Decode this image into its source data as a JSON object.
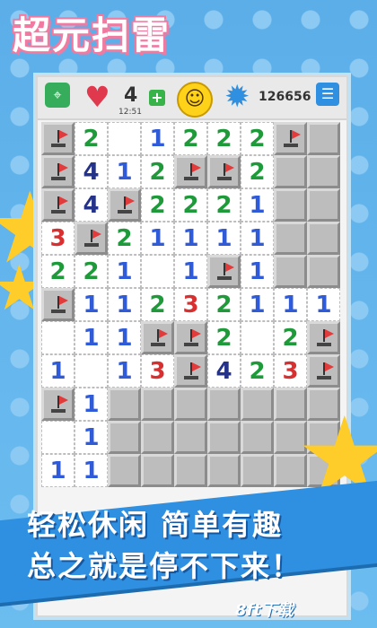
{
  "title": "超元扫雷",
  "topbar": {
    "lives": "4",
    "timer": "12:51",
    "score": "126656",
    "location_icon": "location-pin-icon",
    "heart_icon": "heart-icon",
    "plus_icon": "plus-icon",
    "smile_icon": "smiley-face-icon",
    "gear_icon": "gear-icon",
    "menu_icon": "menu-list-icon"
  },
  "board": {
    "rows": [
      [
        "F",
        "2",
        "",
        "1",
        "2",
        "2",
        "2",
        "F",
        "C"
      ],
      [
        "F",
        "4",
        "1",
        "2",
        "F",
        "F",
        "2",
        "C",
        "C"
      ],
      [
        "F",
        "4",
        "F",
        "2",
        "2",
        "2",
        "1",
        "C",
        "C"
      ],
      [
        "3",
        "F",
        "2",
        "1",
        "1",
        "1",
        "1",
        "C",
        "C"
      ],
      [
        "2",
        "2",
        "1",
        "",
        "1",
        "F",
        "1",
        "C",
        "C"
      ],
      [
        "F",
        "1",
        "1",
        "2",
        "3",
        "2",
        "1",
        "1",
        "1"
      ],
      [
        "",
        "1",
        "1",
        "F",
        "F",
        "2",
        "",
        "2",
        "F"
      ],
      [
        "1",
        "",
        "1",
        "3",
        "F",
        "4",
        "2",
        "3",
        "F"
      ],
      [
        "F",
        "1",
        "C",
        "C",
        "C",
        "C",
        "C",
        "C",
        "C"
      ],
      [
        "",
        "1",
        "C",
        "C",
        "C",
        "C",
        "C",
        "C",
        "C"
      ],
      [
        "1",
        "1",
        "C",
        "C",
        "C",
        "C",
        "C",
        "C",
        "C"
      ]
    ]
  },
  "slogan": {
    "line1": "轻松休闲  简单有趣",
    "line2": "总之就是停不下来！"
  },
  "watermark": "8ft下载",
  "colors": {
    "banner": "#2f8fe0",
    "background": "#66b6ee",
    "star": "#ffcd2a",
    "title_outline": "#f07aa0"
  }
}
